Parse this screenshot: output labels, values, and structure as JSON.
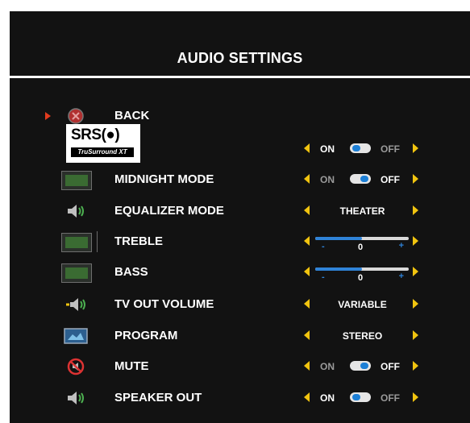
{
  "title": "AUDIO SETTINGS",
  "srs": {
    "text": "SRS(●)",
    "tagline": "TruSurround XT"
  },
  "rows": [
    {
      "label": "BACK"
    },
    {
      "label": "",
      "on": "ON",
      "off": "OFF",
      "state": "ON"
    },
    {
      "label": "MIDNIGHT MODE",
      "on": "ON",
      "off": "OFF",
      "state": "OFF"
    },
    {
      "label": "EQUALIZER MODE",
      "value": "THEATER"
    },
    {
      "label": "TREBLE",
      "minus": "-",
      "value": "0",
      "plus": "+",
      "level": 0.5
    },
    {
      "label": "BASS",
      "minus": "-",
      "value": "0",
      "plus": "+",
      "level": 0.5
    },
    {
      "label": "TV OUT VOLUME",
      "value": "VARIABLE"
    },
    {
      "label": "PROGRAM",
      "value": "STEREO"
    },
    {
      "label": "MUTE",
      "on": "ON",
      "off": "OFF",
      "state": "OFF"
    },
    {
      "label": "SPEAKER OUT",
      "on": "ON",
      "off": "OFF",
      "state": "ON"
    }
  ],
  "colors": {
    "background": "#121212",
    "arrow": "#f1c40f",
    "pointer": "#e23b1e",
    "accent": "#2f83d8"
  }
}
